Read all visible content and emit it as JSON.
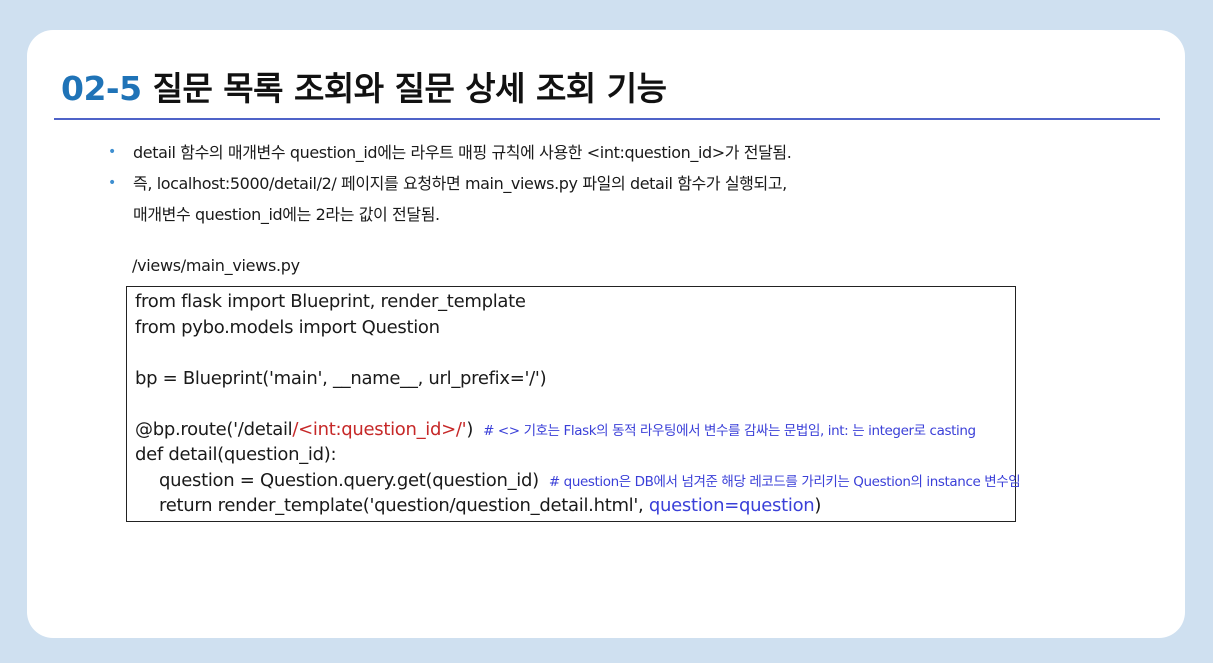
{
  "title": {
    "number": "02-5",
    "text": "질문 목록 조회와 질문 상세 조회 기능"
  },
  "bullets": [
    {
      "lines": [
        "detail 함수의 매개변수 question_id에는 라우트 매핑 규칙에 사용한 <int:question_id>가 전달됨."
      ]
    },
    {
      "lines": [
        "즉, localhost:5000/detail/2/ 페이지를 요청하면 main_views.py 파일의 detail 함수가 실행되고,",
        "매개변수 question_id에는 2라는 값이 전달됨."
      ]
    }
  ],
  "code_file": "/views/main_views.py",
  "code": {
    "line1": "from flask import Blueprint, render_template",
    "line2": "from pybo.models import Question",
    "line3": "bp = Blueprint('main', __name__, url_prefix='/')",
    "line4_prefix": "@bp.route('/detail",
    "line4_highlight": "/<int:question_id>/'",
    "line4_suffix": ")",
    "line4_comment": "# <> 기호는 Flask의 동적 라우팅에서 변수를 감싸는 문법임, int:  는 integer로 casting",
    "line5": "def detail(question_id):",
    "line6": "question = Question.query.get(question_id)",
    "line6_comment": "# question은 DB에서 넘겨준 해당 레코드를 가리키는 Question의 instance 변수임",
    "line7_prefix": "return render_template('question/question_detail.html', ",
    "line7_highlight": "question=question",
    "line7_suffix": ")"
  },
  "colors": {
    "title_number": "#1f73b7",
    "rule": "#4f63c8",
    "highlight_red": "#c62828",
    "comment_blue": "#3a3fd8",
    "background": "#cfe0f0"
  }
}
